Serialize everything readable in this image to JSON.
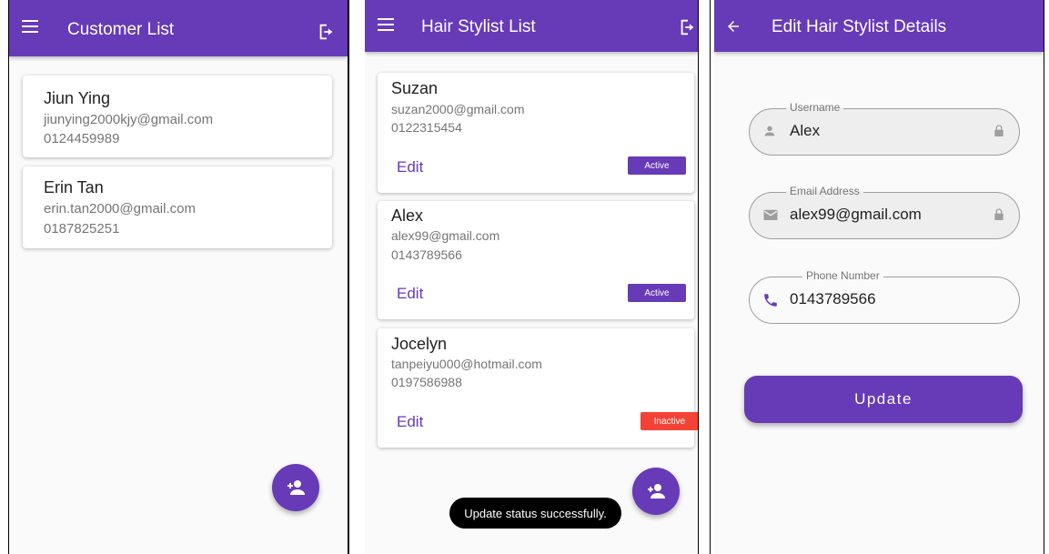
{
  "screen1": {
    "title": "Customer List",
    "customers": [
      {
        "name": "Jiun Ying",
        "email": "jiunying2000kjy@gmail.com",
        "phone": "0124459989"
      },
      {
        "name": "Erin Tan",
        "email": "erin.tan2000@gmail.com",
        "phone": "0187825251"
      }
    ]
  },
  "screen2": {
    "title": "Hair Stylist List",
    "edit_label": "Edit",
    "stylists": [
      {
        "name": "Suzan",
        "email": "suzan2000@gmail.com",
        "phone": "0122315454",
        "status": "Active"
      },
      {
        "name": "Alex",
        "email": "alex99@gmail.com",
        "phone": "0143789566",
        "status": "Active"
      },
      {
        "name": "Jocelyn",
        "email": "tanpeiyu000@hotmail.com",
        "phone": "0197586988",
        "status": "Inactive"
      }
    ],
    "snackbar": "Update status successfully."
  },
  "screen3": {
    "title": "Edit Hair Stylist Details",
    "username": {
      "label": "Username",
      "value": "Alex"
    },
    "email": {
      "label": "Email Address",
      "value": "alex99@gmail.com"
    },
    "phone": {
      "label": "Phone Number",
      "value": "0143789566"
    },
    "update_label": "Update"
  },
  "colors": {
    "primary": "#673ab7",
    "active": "#673ab7",
    "inactive": "#f44336"
  }
}
